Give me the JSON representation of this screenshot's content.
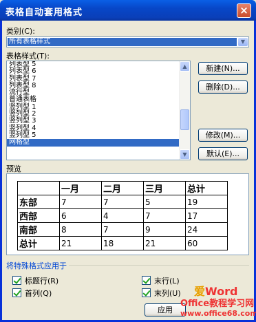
{
  "title": "表格自动套用格式",
  "close_glyph": "×",
  "category": {
    "label": "类别(C):",
    "selected": "所有表格样式"
  },
  "styles": {
    "label": "表格样式(T):",
    "items": [
      "列表型 5",
      "列表型 6",
      "列表型 7",
      "列表型 8",
      "流行型",
      "普通表格",
      "竖列型 1",
      "竖列型 2",
      "竖列型 3",
      "竖列型 4",
      "竖列型 5",
      "网格型"
    ],
    "selected": "网格型"
  },
  "buttons": {
    "new": "新建(N)...",
    "delete": "删除(D)...",
    "modify": "修改(M)...",
    "default": "默认(E)...",
    "apply": "应用"
  },
  "preview": {
    "label": "预览",
    "header": [
      "",
      "一月",
      "二月",
      "三月",
      "总计"
    ],
    "rows": [
      [
        "东部",
        "7",
        "7",
        "5",
        "19"
      ],
      [
        "西部",
        "6",
        "4",
        "7",
        "17"
      ],
      [
        "南部",
        "8",
        "7",
        "9",
        "24"
      ],
      [
        "总计",
        "21",
        "18",
        "21",
        "60"
      ]
    ]
  },
  "apply_section": {
    "label": "将特殊格式应用于",
    "options": [
      {
        "label": "标题行(R)",
        "checked": true
      },
      {
        "label": "首列(Q)",
        "checked": true
      },
      {
        "label": "末行(L)",
        "checked": true
      },
      {
        "label": "末列(U)",
        "checked": true
      }
    ]
  },
  "watermark": {
    "line1": "Office教程学习网",
    "line2": "www.office68.com",
    "brand": "Word"
  }
}
